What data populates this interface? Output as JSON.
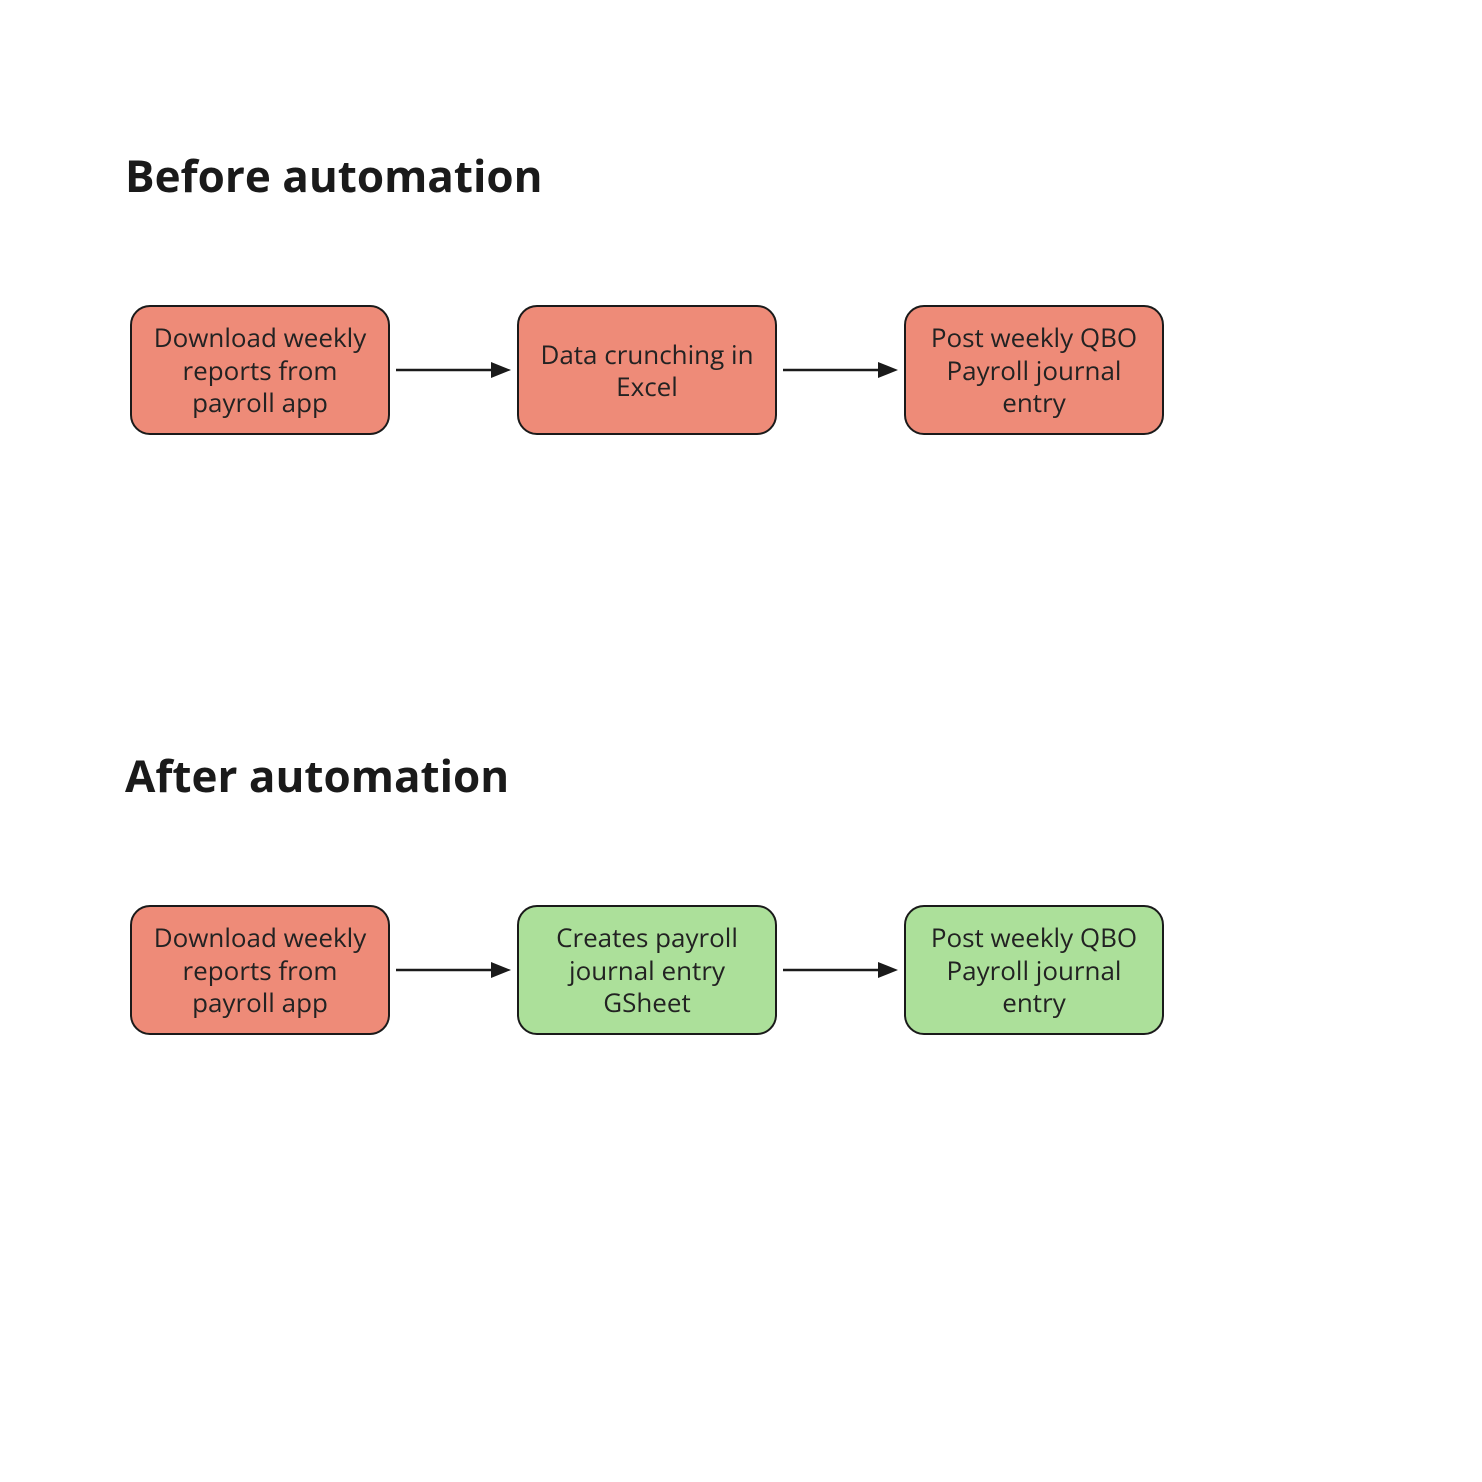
{
  "colors": {
    "red": "#ee8b78",
    "green": "#ace09a",
    "stroke": "#1a1a1a"
  },
  "sections": {
    "before": {
      "title": "Before automation",
      "nodes": {
        "n1": {
          "label": "Download weekly reports from payroll app",
          "color": "red"
        },
        "n2": {
          "label": "Data crunching in Excel",
          "color": "red"
        },
        "n3": {
          "label": "Post weekly QBO Payroll journal entry",
          "color": "red"
        }
      }
    },
    "after": {
      "title": "After automation",
      "nodes": {
        "n1": {
          "label": "Download weekly reports from payroll app",
          "color": "red"
        },
        "n2": {
          "label": "Creates payroll journal entry GSheet",
          "color": "green"
        },
        "n3": {
          "label": "Post weekly QBO Payroll journal entry",
          "color": "green"
        }
      }
    }
  }
}
